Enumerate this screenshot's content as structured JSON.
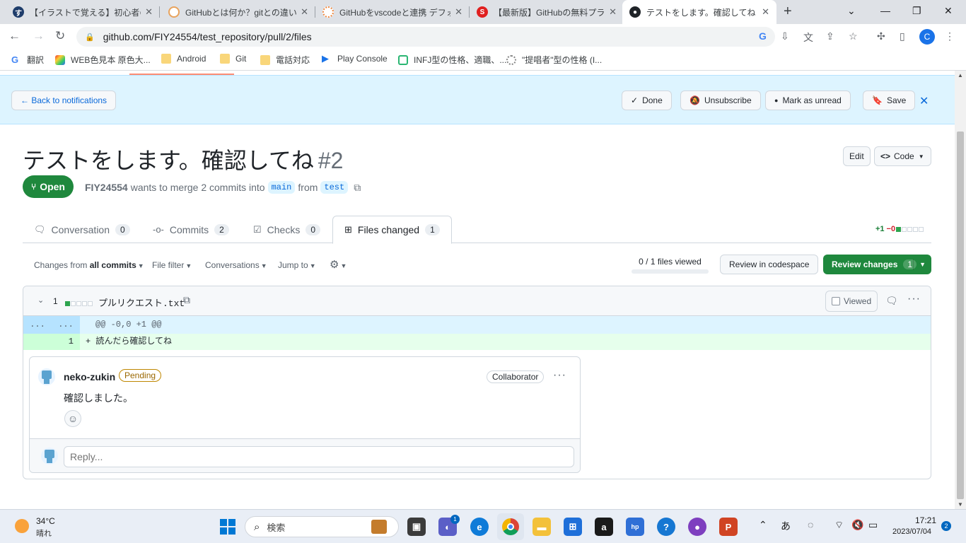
{
  "browser": {
    "tabs": [
      {
        "title": "【イラストで覚える】初心者のため",
        "favicon_char": "す",
        "favicon_color": "#1f3d6b"
      },
      {
        "title": "GitHubとは何か？gitとの違いや",
        "favicon_char": "",
        "favicon_color": "#e8a35d"
      },
      {
        "title": "GitHubをvscodeと連携 デフォル",
        "favicon_char": "",
        "favicon_color": "#f0883e"
      },
      {
        "title": "【最新版】GitHubの無料プランで",
        "favicon_char": "",
        "favicon_color": "#e02020"
      },
      {
        "title": "テストをします。確認してね by FI",
        "favicon_char": "",
        "favicon_color": "#1f2328"
      }
    ],
    "url": "github.com/FIY24554/test_repository/pull/2/files",
    "profile_initial": "C",
    "bookmarks": [
      {
        "label": "翻訳",
        "icon": "google-icon"
      },
      {
        "label": "WEB色見本 原色大...",
        "icon": "color-icon"
      },
      {
        "label": "Android",
        "icon": "folder-icon"
      },
      {
        "label": "Git",
        "icon": "folder-icon"
      },
      {
        "label": "電話対応",
        "icon": "folder-icon"
      },
      {
        "label": "Play Console",
        "icon": "play-console-icon"
      },
      {
        "label": "INFJ型の性格、適職、...",
        "icon": "site-icon"
      },
      {
        "label": "\"提唱者\"型の性格 (I...",
        "icon": "site-icon"
      }
    ]
  },
  "notifications": {
    "back": "← Back to notifications",
    "done": "Done",
    "unsubscribe": "Unsubscribe",
    "mark_unread": "Mark as unread",
    "save": "Save"
  },
  "pr": {
    "title": "テストをします。確認してね",
    "number": "#2",
    "edit": "Edit",
    "code": "Code",
    "state": "Open",
    "author": "FIY24554",
    "meta_text": "wants to merge 2 commits into",
    "base_branch": "main",
    "from_text": "from",
    "head_branch": "test"
  },
  "tabs": [
    {
      "label": "Conversation",
      "count": "0"
    },
    {
      "label": "Commits",
      "count": "2"
    },
    {
      "label": "Checks",
      "count": "0"
    },
    {
      "label": "Files changed",
      "count": "1"
    }
  ],
  "diffstat": {
    "additions": "+1",
    "deletions": "−0"
  },
  "file_toolbar": {
    "changes_from_prefix": "Changes from",
    "changes_from_value": "all commits",
    "file_filter": "File filter",
    "conversations": "Conversations",
    "jump_to": "Jump to",
    "files_viewed": "0 / 1 files viewed",
    "review_codespace": "Review in codespace",
    "review_changes": "Review changes",
    "review_count": "1"
  },
  "file": {
    "change_count": "1",
    "name": "プルリクエスト.txt",
    "viewed_label": "Viewed",
    "hunk_left": "...",
    "hunk_right": "...",
    "hunk_header": "@@ -0,0 +1 @@",
    "added_line_number": "1",
    "added_line": "+ 読んだら確認してね"
  },
  "comment": {
    "author": "neko-zukin",
    "status": "Pending",
    "role": "Collaborator",
    "body": "確認しました。",
    "reply_placeholder": "Reply..."
  },
  "taskbar": {
    "temperature": "34°C",
    "weather": "晴れ",
    "search_placeholder": "検索",
    "ime": "あ",
    "time": "17:21",
    "date": "2023/07/04",
    "notification_count": "2",
    "teams_badge": "1"
  },
  "colors": {
    "accent_green": "#1f883d",
    "link_blue": "#0969da",
    "notification_bg": "#ddf4ff",
    "pending_yellow": "#9a6700"
  }
}
